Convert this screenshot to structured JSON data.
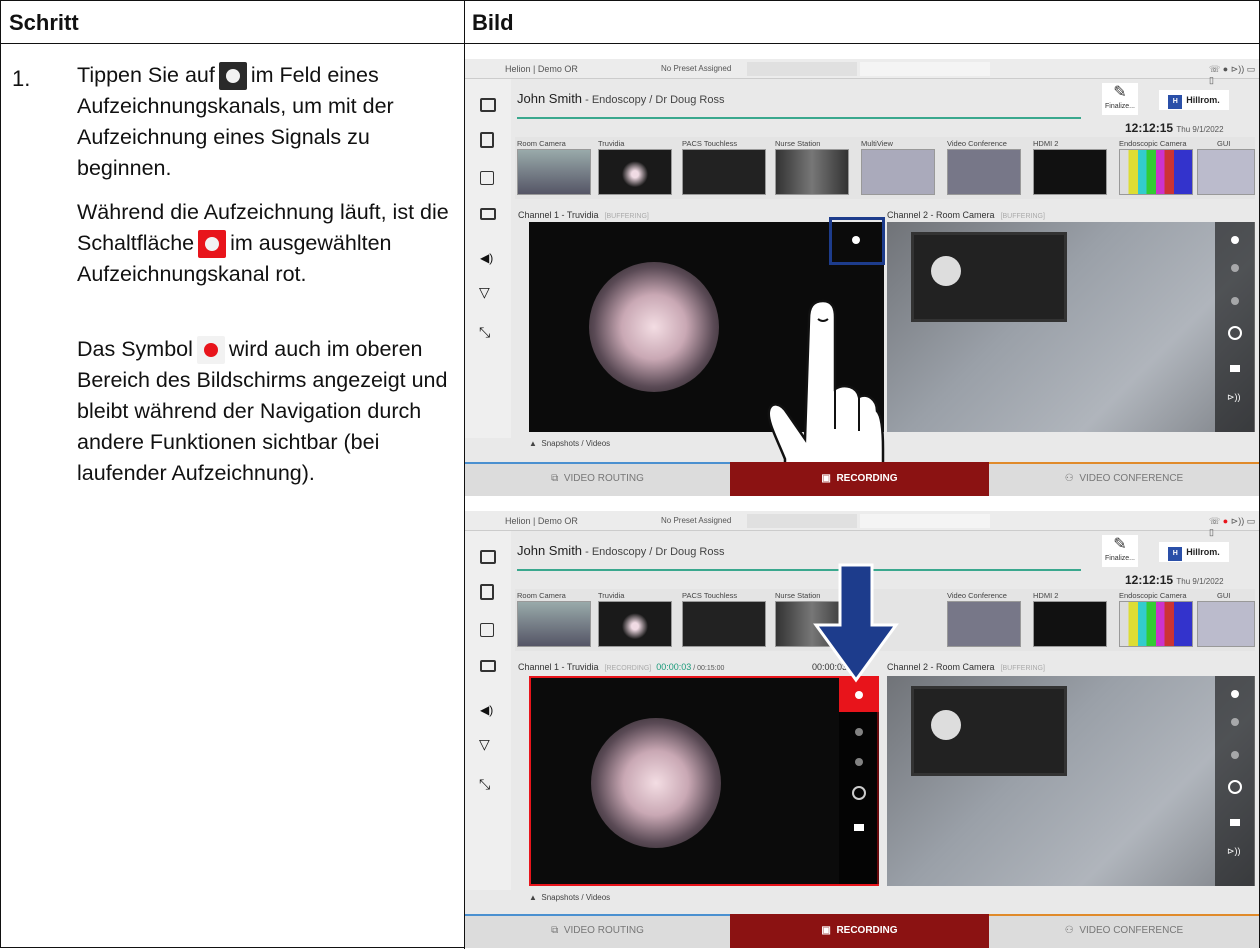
{
  "header": {
    "col1": "Schritt",
    "col2": "Bild"
  },
  "step": {
    "number": "1.",
    "line_a": "Tippen Sie auf",
    "line_b": "im Feld eines Aufzeichnungskanals, um mit der Aufzeichnung eines Signals zu beginnen.",
    "line_c": "Während die Aufzeichnung läuft, ist die Schaltfläche",
    "line_d": "im ausgewählten Aufzeichnungskanal rot.",
    "line_e": "Das Symbol",
    "line_f": "wird auch im oberen Bereich des Bildschirms angezeigt und bleibt während der Navigation durch andere Funktionen sichtbar (bei laufender Aufzeichnung)."
  },
  "screen": {
    "location": "Helion | Demo OR",
    "preset": "No Preset Assigned",
    "patient_name": "John Smith",
    "procedure": " - Endoscopy / Dr Doug Ross",
    "finalize": "Finalize...",
    "brand": "Hillrom.",
    "brand_logo": "H",
    "time": "12:12:15",
    "date": "Thu 9/1/2022",
    "sources": [
      "Room Camera",
      "Truvidia",
      "PACS Touchless",
      "Nurse Station",
      "MultiView",
      "Video Conference",
      "HDMI 2",
      "Endoscopic Camera",
      "GUI"
    ],
    "channel1": "Channel 1 - Truvidia",
    "channel2": "Channel 2 - Room Camera",
    "buffering": "[BUFFERING]",
    "recording_tag": "[RECORDING]",
    "elapsed": "00:00:03",
    "limit": " / 00:15:00",
    "elapsed_right": "00:00:03",
    "snapshots": "Snapshots / Videos",
    "tab_routing": "VIDEO ROUTING",
    "tab_recording": "RECORDING",
    "tab_conference": "VIDEO CONFERENCE"
  },
  "colors": {
    "record_red": "#e8141b",
    "active_tab": "#8b1212",
    "accent_teal": "#3aa88e",
    "arrow_blue": "#1d3c8c"
  }
}
